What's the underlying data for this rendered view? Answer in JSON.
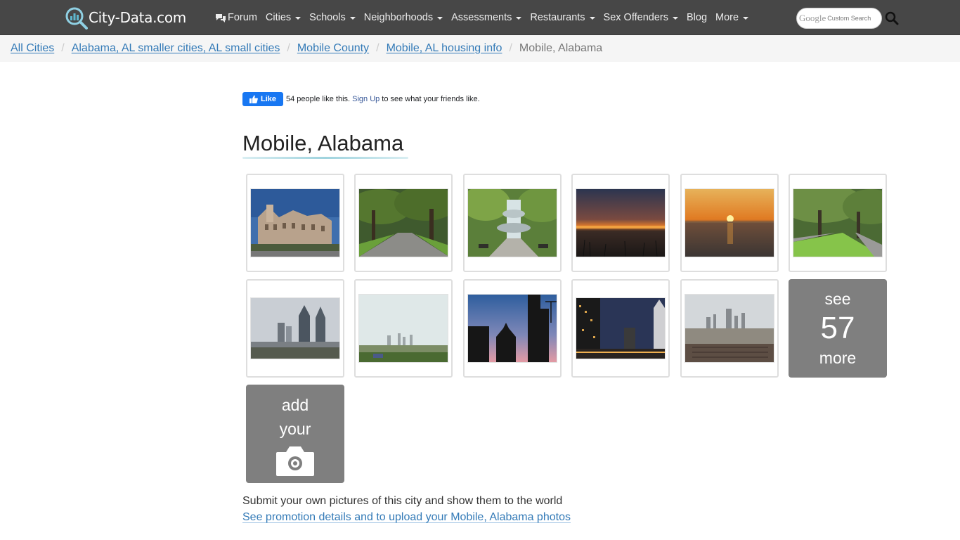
{
  "header": {
    "logo_text": "City-Data.com",
    "nav": [
      {
        "label": "Forum",
        "dropdown": false
      },
      {
        "label": "Cities",
        "dropdown": true
      },
      {
        "label": "Schools",
        "dropdown": true
      },
      {
        "label": "Neighborhoods",
        "dropdown": true
      },
      {
        "label": "Assessments",
        "dropdown": true
      },
      {
        "label": "Restaurants",
        "dropdown": true
      },
      {
        "label": "Sex Offenders",
        "dropdown": true
      },
      {
        "label": "Blog",
        "dropdown": false
      },
      {
        "label": "More",
        "dropdown": true
      }
    ],
    "search": {
      "brand": "Google",
      "placeholder": "Custom Search"
    }
  },
  "breadcrumb": {
    "items": [
      "All Cities",
      "Alabama, AL smaller cities, AL small cities",
      "Mobile County",
      "Mobile, AL housing info"
    ],
    "current": "Mobile, Alabama",
    "separator": "/"
  },
  "facebook": {
    "button_label": "Like",
    "text_before": "54 people like this.",
    "signup_label": "Sign Up",
    "text_after": "to see what your friends like."
  },
  "page": {
    "title": "Mobile, Alabama"
  },
  "gallery": {
    "photos": [
      {
        "subject": "historic-building"
      },
      {
        "subject": "oak-lined-road"
      },
      {
        "subject": "park-fountain"
      },
      {
        "subject": "bay-sunset"
      },
      {
        "subject": "orange-sunset-water"
      },
      {
        "subject": "moss-oak-road"
      },
      {
        "subject": "skyline-overpass"
      },
      {
        "subject": "distant-skyline"
      },
      {
        "subject": "cathedral-silhouette"
      },
      {
        "subject": "night-skyline"
      },
      {
        "subject": "city-aerial"
      }
    ],
    "see_more": {
      "word1": "see",
      "count": "57",
      "word2": "more"
    },
    "add_photo": {
      "word1": "add",
      "word2": "your"
    }
  },
  "footer_text": {
    "submit": "Submit your own pictures of this city and show them to the world",
    "upload_link": "See promotion details and to upload your Mobile, Alabama photos"
  },
  "colors": {
    "navbar_bg": "#474747",
    "link": "#337ab7",
    "tile_gray": "#7f7f7f",
    "facebook_blue": "#1877f2"
  }
}
